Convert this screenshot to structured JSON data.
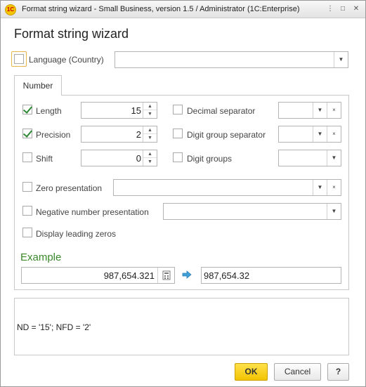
{
  "window": {
    "title": "Format string wizard - Small Business, version 1.5 / Administrator  (1C:Enterprise)",
    "app_logo": "1C",
    "more_label": "⋮",
    "maximize_label": "□",
    "close_label": "✕"
  },
  "heading": "Format string wizard",
  "language": {
    "label": "Language (Country)",
    "checked": false,
    "value": ""
  },
  "tab": {
    "label": "Number"
  },
  "left": {
    "length": {
      "label": "Length",
      "checked": true,
      "value": "15"
    },
    "precision": {
      "label": "Precision",
      "checked": true,
      "value": "2"
    },
    "shift": {
      "label": "Shift",
      "checked": false,
      "value": "0"
    }
  },
  "right": {
    "decimal_separator": {
      "label": "Decimal separator",
      "checked": false
    },
    "digit_group_separator": {
      "label": "Digit group separator",
      "checked": false
    },
    "digit_groups": {
      "label": "Digit groups",
      "checked": false
    }
  },
  "zero_presentation": {
    "label": "Zero presentation",
    "checked": false
  },
  "negative_number_presentation": {
    "label": "Negative number presentation",
    "checked": false
  },
  "display_leading_zeros": {
    "label": "Display leading zeros",
    "checked": false
  },
  "example": {
    "title": "Example",
    "input_value": "987,654.321",
    "result_value": "987,654.32"
  },
  "output": {
    "format_string": "ND = '15'; NFD = '2'"
  },
  "buttons": {
    "ok": "OK",
    "cancel": "Cancel",
    "help": "?"
  },
  "glyphs": {
    "spin_up": "▲",
    "spin_down": "▼",
    "dropdown": "▼",
    "clear": "×"
  },
  "colors": {
    "accent_green": "#3a8a2a",
    "ok_button": "#f2c300",
    "arrow_blue": "#3fa0d8"
  }
}
